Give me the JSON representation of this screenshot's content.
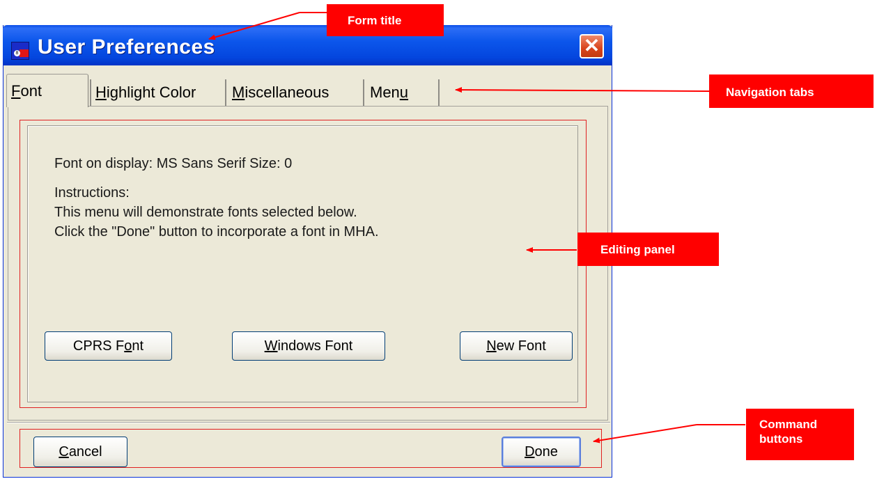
{
  "window": {
    "title": "User Preferences",
    "close_glyph": "✕",
    "title_bar_color": "#0a4ee8",
    "icon_badge": "8"
  },
  "tabs": [
    {
      "mn": "F",
      "rest": "ont"
    },
    {
      "mn": "H",
      "rest": "ighlight Color"
    },
    {
      "mn": "M",
      "rest": "iscellaneous"
    },
    {
      "pre": "Men",
      "mn": "u"
    }
  ],
  "panel": {
    "font_info": "Font on display: MS Sans Serif   Size: 0",
    "instructions_heading": "Instructions:",
    "instructions_line1": "This menu will demonstrate fonts selected below.",
    "instructions_line2": "Click the \"Done\" button to incorporate a font in MHA.",
    "cprs_font": {
      "pre": "CPRS F",
      "mn": "o",
      "rest": "nt"
    },
    "windows_font": {
      "mn": "W",
      "rest": "indows Font"
    },
    "new_font": {
      "mn": "N",
      "rest": "ew Font"
    }
  },
  "commands": {
    "cancel": {
      "mn": "C",
      "rest": "ancel"
    },
    "done": {
      "mn": "D",
      "rest": "one"
    }
  },
  "callouts": {
    "form_title": "Form title",
    "navigation_tabs": "Navigation tabs",
    "editing_panel": "Editing panel",
    "command_buttons_line1": "Command",
    "command_buttons_line2": "buttons",
    "color": "#ff0000"
  }
}
